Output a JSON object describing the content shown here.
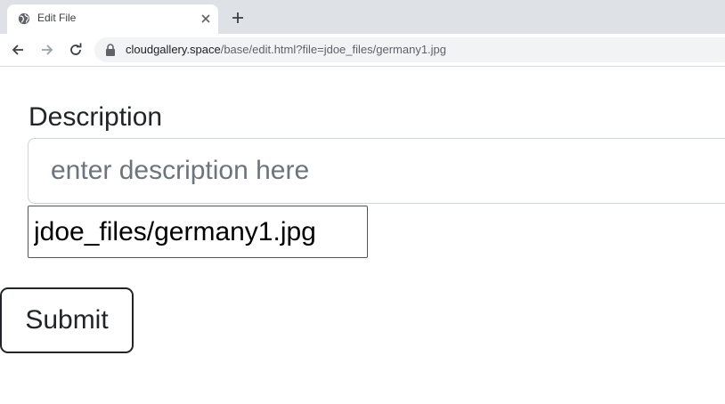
{
  "browser": {
    "tab": {
      "title": "Edit File",
      "favicon_icon": "globe-icon",
      "close_icon": "close-icon"
    },
    "new_tab_icon": "plus-icon",
    "nav": {
      "back_icon": "arrow-left-icon",
      "forward_icon": "arrow-right-icon",
      "reload_icon": "reload-icon"
    },
    "address_bar": {
      "lock_icon": "lock-icon",
      "host": "cloudgallery.space",
      "path": "/base/edit.html?file=jdoe_files/germany1.jpg"
    }
  },
  "form": {
    "description_label": "Description",
    "description_placeholder": "enter description here",
    "description_value": "",
    "file_value": "jdoe_files/germany1.jpg",
    "submit_label": "Submit"
  },
  "colors": {
    "tabstrip_bg": "#dee1e6",
    "omnibox_bg": "#f1f3f4",
    "text_dark": "#212529",
    "placeholder": "#6c757d",
    "input_border": "#ced4da"
  }
}
